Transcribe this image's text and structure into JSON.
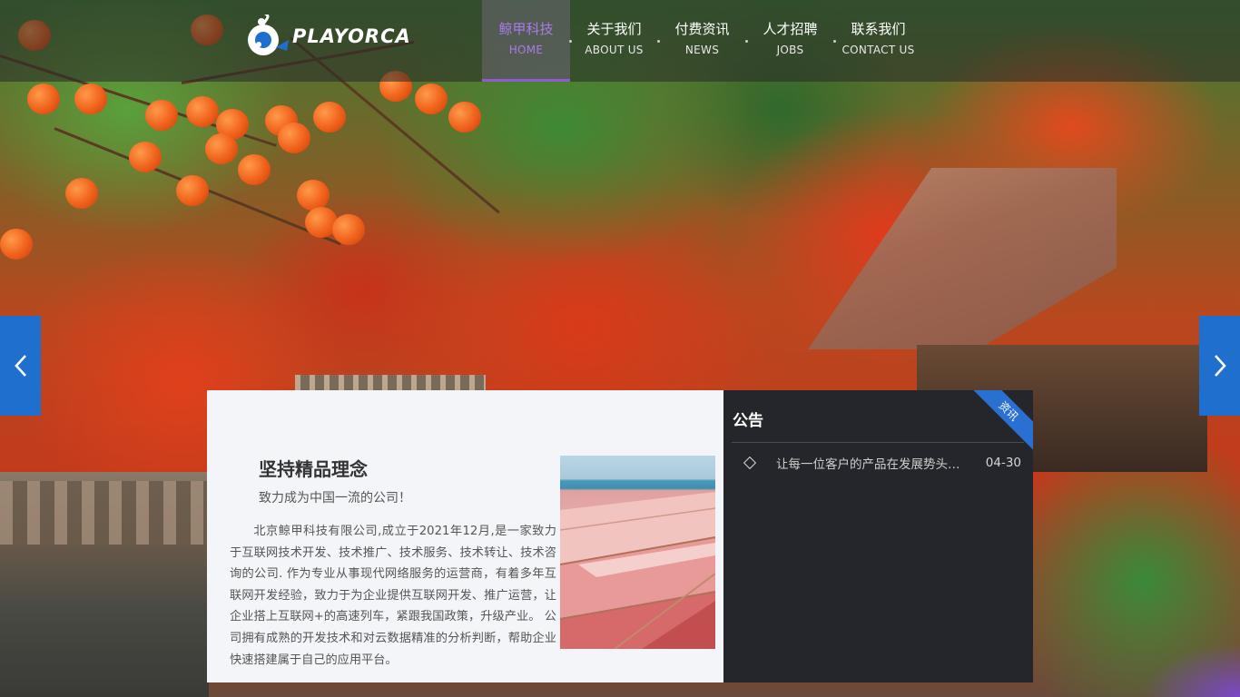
{
  "header": {
    "logo_text": "PLAYORCA",
    "nav": [
      {
        "zh": "鲸甲科技",
        "en": "HOME",
        "active": true
      },
      {
        "zh": "关于我们",
        "en": "ABOUT US",
        "active": false
      },
      {
        "zh": "付费资讯",
        "en": "NEWS",
        "active": false
      },
      {
        "zh": "人才招聘",
        "en": "JOBS",
        "active": false
      },
      {
        "zh": "联系我们",
        "en": "CONTACT US",
        "active": false
      }
    ]
  },
  "slider": {
    "prev_icon": "chevron-left-icon",
    "next_icon": "chevron-right-icon"
  },
  "about": {
    "title": "坚持精品理念",
    "subtitle": "致力成为中国一流的公司！",
    "body": "北京鲸甲科技有限公司,成立于2021年12月,是一家致力于互联网技术开发、技术推广、技术服务、技术转让、技术咨询的公司. 作为专业从事现代网络服务的运营商，有着多年互联网开发经验，致力于为企业提供互联网开发、推广运营，让企业搭上互联网+的高速列车，紧跟我国政策，升级产业。 公司拥有成熟的开发技术和对云数据精准的分析判断，帮助企业快速搭建属于自己的应用平台。"
  },
  "notice": {
    "title": "公告",
    "ribbon": "资讯",
    "items": [
      {
        "text": "让每一位客户的产品在发展势头…",
        "date": "04-30"
      }
    ]
  },
  "colors": {
    "accent_purple": "#8e5bd6",
    "arrow_blue": "#1f6fcf",
    "notice_bg": "#25262b"
  }
}
